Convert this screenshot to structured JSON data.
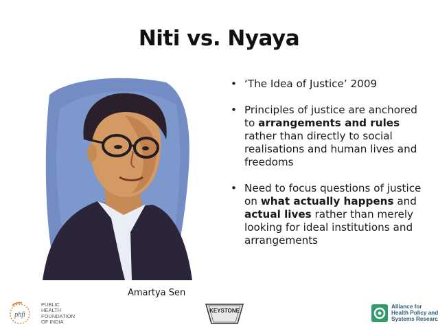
{
  "slide": {
    "title": "Niti vs. Nyaya",
    "portrait_caption": "Amartya Sen",
    "bullets": [
      {
        "text": "‘The Idea of Justice’ 2009"
      },
      {
        "pre": "Principles of justice are anchored to ",
        "bold1": "arrangements and rules",
        "post": " rather than directly to social realisations and human lives and freedoms"
      },
      {
        "pre": "Need to focus questions of justice on ",
        "bold1": "what actually happens",
        "mid": " and ",
        "bold2": "actual lives",
        "post": " rather than merely looking for ideal institutions and arrangements"
      }
    ]
  },
  "footer": {
    "phfi": {
      "mark": "phfi",
      "lines": [
        "Public",
        "Health",
        "Foundation",
        "of India"
      ]
    },
    "keystone_label": "KEYSTONE",
    "ahpsr": {
      "lines": [
        "Alliance for",
        "Health Policy and",
        "Systems Research"
      ]
    }
  },
  "colors": {
    "title": "#111111",
    "text": "#1a1a1a",
    "ahpsr_blue": "#2a5a78",
    "ahpsr_green": "#2f9a6e"
  }
}
